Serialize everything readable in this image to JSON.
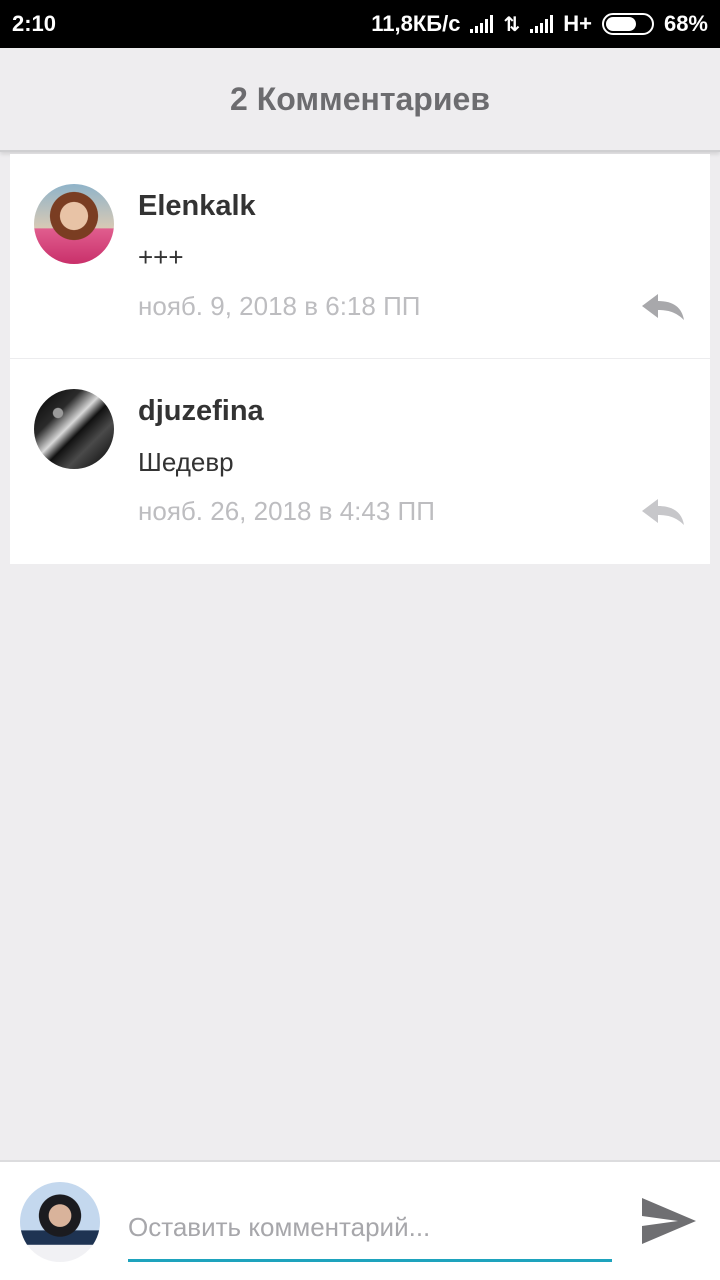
{
  "status_bar": {
    "time": "2:10",
    "speed": "11,8КБ/с",
    "network": "H+",
    "battery": "68%",
    "battery_level": 0.68
  },
  "header": {
    "title": "2 Комментариев"
  },
  "comments": [
    {
      "author": "Elenkalk",
      "text": "+++",
      "date": "нояб. 9, 2018 в 6:18 ПП"
    },
    {
      "author": "djuzefina",
      "text": "Шедевр",
      "date": "нояб. 26, 2018 в 4:43 ПП"
    }
  ],
  "composer": {
    "placeholder": "Оставить комментарий..."
  },
  "icons": {
    "reply": "reply-arrow-icon",
    "send": "send-icon",
    "wifi": "signal-bars-icon",
    "data": "data-transfer-icon"
  }
}
